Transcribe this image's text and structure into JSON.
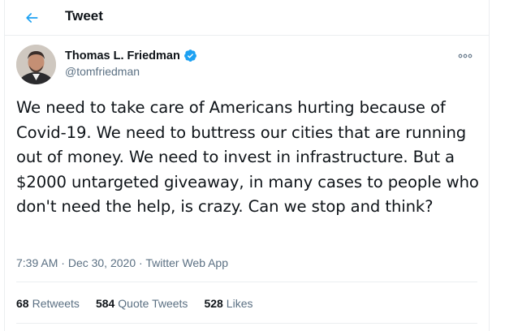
{
  "header": {
    "title": "Tweet",
    "back_icon": "arrow-left-icon"
  },
  "author": {
    "name": "Thomas L. Friedman",
    "handle": "@tomfriedman",
    "verified": true
  },
  "tweet": {
    "text": "We need to take care of Americans hurting because of Covid-19. We need to buttress our cities that are running out of money. We need to invest in infrastructure. But a $2000 untargeted giveaway, in many cases to people who don't need the help, is crazy. Can we stop and think?",
    "time": "7:39 AM",
    "date": "Dec 30, 2020",
    "separator": " · ",
    "source": "Twitter Web App"
  },
  "stats": {
    "retweets_count": "68",
    "retweets_label": "Retweets",
    "quotes_count": "584",
    "quotes_label": "Quote Tweets",
    "likes_count": "528",
    "likes_label": "Likes"
  },
  "colors": {
    "accent": "#1da1f2",
    "muted": "#5b7083",
    "text": "#0f1419",
    "border": "#ebeef0"
  }
}
